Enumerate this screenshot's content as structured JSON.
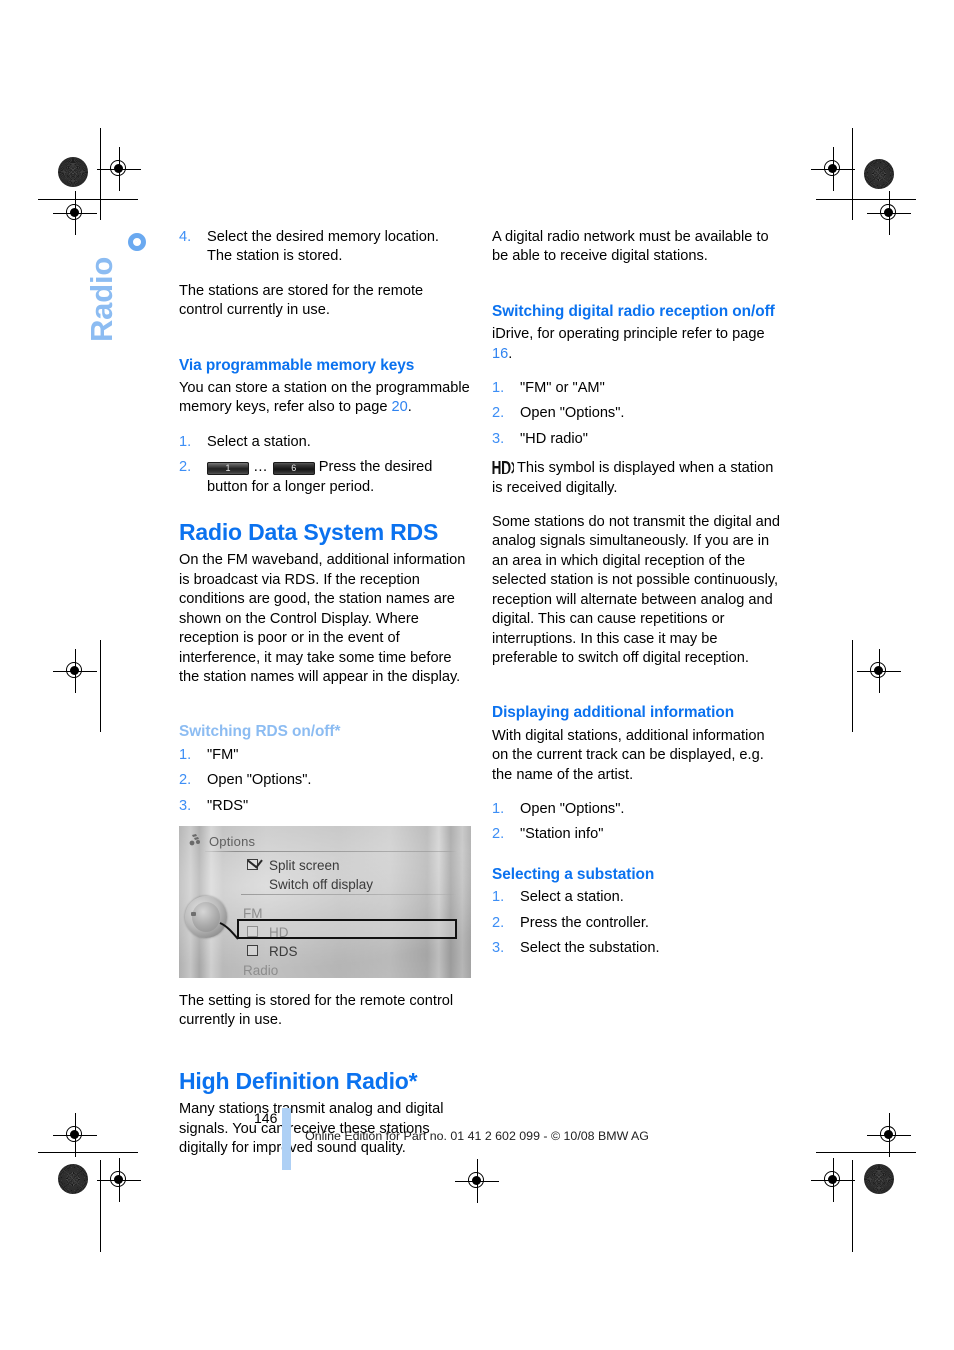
{
  "side_tab": {
    "label": "Radio"
  },
  "page": {
    "number": "146"
  },
  "footer": {
    "text": "Online Edition for Part no. 01 41 2 602 099 - © 10/08 BMW AG"
  },
  "colors": {
    "heading_blue": "#0b72ef",
    "light_blue": "#8cbcf2",
    "number_blue": "#3d8ef5",
    "page_bar_blue": "#aed0f5"
  },
  "left_column": {
    "continued_step": {
      "num": "4.",
      "line1": "Select the desired memory location.",
      "line2": "The station is stored."
    },
    "para_stored": "The stations are stored for the remote control currently in use.",
    "sub_memory_keys": {
      "heading": "Via programmable memory keys",
      "intro_before_link": "You can store a station on the programmable memory keys, refer also to page ",
      "intro_link": "20",
      "intro_after_link": ".",
      "steps": [
        {
          "num": "1.",
          "text": "Select a station."
        },
        {
          "num": "2.",
          "key_low": "1",
          "ellipsis": "…",
          "key_high": "6",
          "text": "Press the desired button for a longer period."
        }
      ]
    },
    "section_rds": {
      "heading": "Radio Data System RDS",
      "body": "On the FM waveband, additional information is broadcast via RDS. If the reception conditions are good, the station names are shown on the Control Display. Where reception is poor or in the event of interference, it may take some time before the station names will appear in the display.",
      "sub_switching": {
        "heading": "Switching RDS on/off*",
        "steps": [
          {
            "num": "1.",
            "text": "\"FM\""
          },
          {
            "num": "2.",
            "text": "Open \"Options\"."
          },
          {
            "num": "3.",
            "text": "\"RDS\""
          }
        ]
      },
      "screenshot": {
        "title": "Options",
        "items": [
          {
            "label": "Split screen",
            "checkbox": "checked",
            "dim": false
          },
          {
            "label": "Switch off display",
            "checkbox": "none",
            "dim": false
          },
          {
            "label": "FM",
            "checkbox": "none",
            "dim": true
          },
          {
            "label": "HD",
            "checkbox": "unchecked",
            "dim": false
          },
          {
            "label": "RDS",
            "checkbox": "unchecked",
            "dim": false,
            "selected": true
          },
          {
            "label": "Radio",
            "checkbox": "none",
            "dim": true
          }
        ]
      },
      "caption": "The setting is stored for the remote control currently in use."
    },
    "section_hd": {
      "heading": "High Definition Radio*",
      "body": "Many stations transmit analog and digital signals. You can receive these stations digitally for improved sound quality."
    }
  },
  "right_column": {
    "para_network": "A digital radio network must be available to be able to receive digital stations.",
    "sub_switching_digital": {
      "heading": "Switching digital radio reception on/off",
      "intro_before_link": "iDrive, for operating principle refer to page ",
      "intro_link": "16",
      "intro_after_link": ".",
      "steps": [
        {
          "num": "1.",
          "text": "\"FM\" or \"AM\""
        },
        {
          "num": "2.",
          "text": "Open \"Options\"."
        },
        {
          "num": "3.",
          "text": "\"HD radio\""
        }
      ],
      "symbol_note": "This symbol is displayed when a station is received digitally.",
      "symbol_name": "hd-radio-icon",
      "para_alternating": "Some stations do not transmit the digital and analog signals simultaneously. If you are in an area in which digital reception of the selected station is not possible continuously, reception will alternate between analog and digital. This can cause repetitions or interruptions. In this case it may be preferable to switch off digital reception."
    },
    "sub_displaying": {
      "heading": "Displaying additional information",
      "body": "With digital stations, additional information on the current track can be displayed, e.g. the name of the artist.",
      "steps": [
        {
          "num": "1.",
          "text": "Open \"Options\"."
        },
        {
          "num": "2.",
          "text": "\"Station info\""
        }
      ]
    },
    "sub_substation": {
      "heading": "Selecting a substation",
      "steps": [
        {
          "num": "1.",
          "text": "Select a station."
        },
        {
          "num": "2.",
          "text": "Press the controller."
        },
        {
          "num": "3.",
          "text": "Select the substation."
        }
      ]
    }
  }
}
